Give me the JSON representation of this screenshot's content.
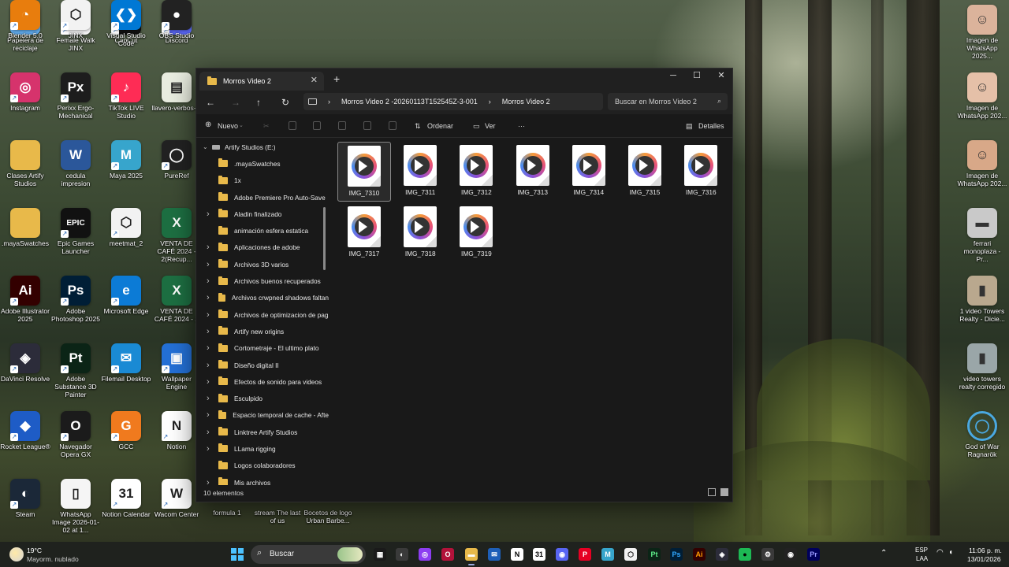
{
  "desktop": {
    "left_icons": [
      {
        "label": "Papelera de reciclaje",
        "glyph": "🗑",
        "bg": "#5fa8e8",
        "shortcut": false
      },
      {
        "label": "Female Walk JINX",
        "glyph": "⬡",
        "bg": "#f2f2f2",
        "shortcut": true
      },
      {
        "label": "CapCut",
        "glyph": "✂",
        "bg": "#111111",
        "shortcut": true
      },
      {
        "label": "Discord",
        "glyph": "◉",
        "bg": "#5865f2",
        "shortcut": true
      },
      {
        "label": "Instagram",
        "glyph": "◎",
        "bg": "#d6336c",
        "shortcut": true
      },
      {
        "label": "Perixx Ergo-Mechanical",
        "glyph": "Px",
        "bg": "#1d1d1d",
        "shortcut": true
      },
      {
        "label": "TikTok LIVE Studio",
        "glyph": "♪",
        "bg": "#fe2c55",
        "shortcut": true
      },
      {
        "label": "llavero-verbos-...",
        "glyph": "▤",
        "bg": "#e9ede0",
        "shortcut": false
      },
      {
        "label": "Clases Artify Studios",
        "glyph": "",
        "bg": "#e8b94a",
        "shortcut": false
      },
      {
        "label": "cedula impresion",
        "glyph": "W",
        "bg": "#2b579a",
        "shortcut": false
      },
      {
        "label": "Maya 2025",
        "glyph": "M",
        "bg": "#37a5cc",
        "shortcut": true
      },
      {
        "label": "PureRef",
        "glyph": "◯",
        "bg": "#222222",
        "shortcut": true
      },
      {
        "label": ".mayaSwatches",
        "glyph": "",
        "bg": "#e8b94a",
        "shortcut": false
      },
      {
        "label": "Epic Games Launcher",
        "glyph": "EPIC",
        "bg": "#111111",
        "shortcut": true
      },
      {
        "label": "meetmat_2",
        "glyph": "⬡",
        "bg": "#f2f2f2",
        "shortcut": true
      },
      {
        "label": "VENTA DE CAFÉ 2024 - 2(Recup...",
        "glyph": "X",
        "bg": "#1d6f42",
        "shortcut": false
      },
      {
        "label": "Adobe Illustrator 2025",
        "glyph": "Ai",
        "bg": "#330000",
        "shortcut": true
      },
      {
        "label": "Adobe Photoshop 2025",
        "glyph": "Ps",
        "bg": "#001e36",
        "shortcut": true
      },
      {
        "label": "Microsoft Edge",
        "glyph": "e",
        "bg": "#0c7bd6",
        "shortcut": true
      },
      {
        "label": "VENTA DE CAFÉ 2024 - 2",
        "glyph": "X",
        "bg": "#1d6f42",
        "shortcut": false
      },
      {
        "label": "DaVinci Resolve",
        "glyph": "◈",
        "bg": "#2c2c3a",
        "shortcut": true
      },
      {
        "label": "Adobe Substance 3D Painter",
        "glyph": "Pt",
        "bg": "#0b2416",
        "shortcut": true
      },
      {
        "label": "Filemail Desktop",
        "glyph": "✉",
        "bg": "#1a8ad4",
        "shortcut": true
      },
      {
        "label": "Wallpaper Engine",
        "glyph": "▣",
        "bg": "#2470d6",
        "shortcut": true
      },
      {
        "label": "Rocket League®",
        "glyph": "◆",
        "bg": "#1e5cc6",
        "shortcut": true
      },
      {
        "label": "Navegador Opera GX",
        "glyph": "O",
        "bg": "#1b1b1b",
        "shortcut": true
      },
      {
        "label": "GCC",
        "glyph": "G",
        "bg": "#f07a1e",
        "shortcut": true
      },
      {
        "label": "Notion",
        "glyph": "N",
        "bg": "#ffffff",
        "shortcut": true
      },
      {
        "label": "Steam",
        "glyph": "◐",
        "bg": "#1b2838",
        "shortcut": true
      },
      {
        "label": "WhatsApp Image 2026-01-02 at 1...",
        "glyph": "▯",
        "bg": "#f5f5f5",
        "shortcut": false
      },
      {
        "label": "Notion Calendar",
        "glyph": "31",
        "bg": "#ffffff",
        "shortcut": true
      },
      {
        "label": "Wacom Center",
        "glyph": "W",
        "bg": "#ffffff",
        "shortcut": true
      },
      {
        "label": "Blender 5.0",
        "glyph": "◔",
        "bg": "#e87d0d",
        "shortcut": true
      },
      {
        "label": "JINX",
        "glyph": "⬡",
        "bg": "#f2f2f2",
        "shortcut": true
      },
      {
        "label": "Visual Studio Code",
        "glyph": "❮❯",
        "bg": "#0078d4",
        "shortcut": true
      },
      {
        "label": "OBS Studio",
        "glyph": "●",
        "bg": "#222222",
        "shortcut": true
      }
    ],
    "behind_window_labels": [
      "formula 1",
      "stream The last of us",
      "Bocetos de logo Urban Barbe..."
    ],
    "right_icons": [
      {
        "label": "Imagen de WhatsApp 2025...",
        "glyph": "☺",
        "bg": "#dbb39b"
      },
      {
        "label": "Imagen de WhatsApp 202...",
        "glyph": "☺",
        "bg": "#e5c0a8"
      },
      {
        "label": "Imagen de WhatsApp 202...",
        "glyph": "☺",
        "bg": "#d8a888"
      },
      {
        "label": "ferrari monoplaza - Pr...",
        "glyph": "▬",
        "bg": "#c9c9c9"
      },
      {
        "label": "1 video Towers Realty - Dicie...",
        "glyph": "▮",
        "bg": "#b9a88e"
      },
      {
        "label": "video towers realty corregido",
        "glyph": "▮",
        "bg": "#9aa6a8"
      },
      {
        "label": "God of War Ragnarök",
        "glyph": "◯",
        "bg": "#1a4f7a"
      }
    ]
  },
  "explorer": {
    "tab_title": "Morros Video 2",
    "tab_close": "✕",
    "new_tab": "+",
    "window_buttons": {
      "minimize": "─",
      "maximize": "☐",
      "close": "✕"
    },
    "nav": {
      "back": "←",
      "forward": "→",
      "up": "↑",
      "refresh": "↻",
      "expand": "›"
    },
    "breadcrumb": [
      "Morros Video 2 -20260113T152545Z-3-001",
      "Morros Video 2"
    ],
    "breadcrumb_sep": "›",
    "search_placeholder": "Buscar en Morros Video 2",
    "search_glyph": "⌕",
    "toolbar": {
      "new": "Nuevo",
      "sort": "Ordenar",
      "view": "Ver",
      "more": "···",
      "details": "Detalles"
    },
    "tree": {
      "root": "Artify Studios (E:)",
      "items": [
        {
          "label": ".mayaSwatches",
          "chev": false
        },
        {
          "label": "1x",
          "chev": false
        },
        {
          "label": "Adobe Premiere Pro Auto-Save",
          "chev": false
        },
        {
          "label": "Aladin finalizado",
          "chev": true
        },
        {
          "label": "animación esfera estatica",
          "chev": false
        },
        {
          "label": "Aplicaciones de adobe",
          "chev": true
        },
        {
          "label": "Archivos 3D varios",
          "chev": true
        },
        {
          "label": "Archivos buenos recuperados",
          "chev": true
        },
        {
          "label": "Archivos crwpned shadows faltan",
          "chev": true
        },
        {
          "label": "Archivos de optimizacion de pag",
          "chev": true
        },
        {
          "label": "Artify new origins",
          "chev": true
        },
        {
          "label": "Cortometraje - El ultimo plato",
          "chev": true
        },
        {
          "label": "Diseño digital II",
          "chev": true
        },
        {
          "label": "Efectos de sonido para videos",
          "chev": true
        },
        {
          "label": "Esculpido",
          "chev": true
        },
        {
          "label": "Espacio temporal de cache - Afte",
          "chev": true
        },
        {
          "label": "Linktree Artify Studios",
          "chev": true
        },
        {
          "label": "LLama rigging",
          "chev": true
        },
        {
          "label": "Logos colaboradores",
          "chev": false
        },
        {
          "label": "Mis archivos",
          "chev": true
        }
      ]
    },
    "files": [
      "IMG_7310",
      "IMG_7311",
      "IMG_7312",
      "IMG_7313",
      "IMG_7314",
      "IMG_7315",
      "IMG_7316",
      "IMG_7317",
      "IMG_7318",
      "IMG_7319"
    ],
    "selected_file": "IMG_7310",
    "status": "10 elementos"
  },
  "taskbar": {
    "weather_temp": "19°C",
    "weather_desc": "Mayorm. nublado",
    "search": "Buscar",
    "lang_top": "ESP",
    "lang_bottom": "LAA",
    "time": "11:06 p. m.",
    "date": "13/01/2026",
    "tray_up": "⌃",
    "apps": [
      {
        "glyph": "▦",
        "bg": "#1a1a1a",
        "color": "#fff"
      },
      {
        "glyph": "◐",
        "bg": "#3a3a3a",
        "color": "#fff"
      },
      {
        "glyph": "◎",
        "bg": "#8d3df1",
        "color": "#fff"
      },
      {
        "glyph": "O",
        "bg": "#b3123a",
        "color": "#fff"
      },
      {
        "glyph": "▬",
        "bg": "#e8b94a",
        "color": "#fff"
      },
      {
        "glyph": "✉",
        "bg": "#1e5fb8",
        "color": "#fff"
      },
      {
        "glyph": "N",
        "bg": "#ffffff",
        "color": "#000"
      },
      {
        "glyph": "31",
        "bg": "#ffffff",
        "color": "#000"
      },
      {
        "glyph": "◉",
        "bg": "#5865f2",
        "color": "#fff"
      },
      {
        "glyph": "P",
        "bg": "#e60023",
        "color": "#fff"
      },
      {
        "glyph": "M",
        "bg": "#37a5cc",
        "color": "#fff"
      },
      {
        "glyph": "⬡",
        "bg": "#f2f2f2",
        "color": "#000"
      },
      {
        "glyph": "Pt",
        "bg": "#0b2416",
        "color": "#5ef08a"
      },
      {
        "glyph": "Ps",
        "bg": "#001e36",
        "color": "#31a8ff"
      },
      {
        "glyph": "Ai",
        "bg": "#330000",
        "color": "#ff9a00"
      },
      {
        "glyph": "◈",
        "bg": "#2c2c3a",
        "color": "#fff"
      },
      {
        "glyph": "●",
        "bg": "#1db954",
        "color": "#000"
      },
      {
        "glyph": "⚙",
        "bg": "#3a3a3a",
        "color": "#fff"
      },
      {
        "glyph": "◉",
        "bg": "#222222",
        "color": "#fff"
      },
      {
        "glyph": "Pr",
        "bg": "#00005b",
        "color": "#9999ff"
      }
    ]
  }
}
